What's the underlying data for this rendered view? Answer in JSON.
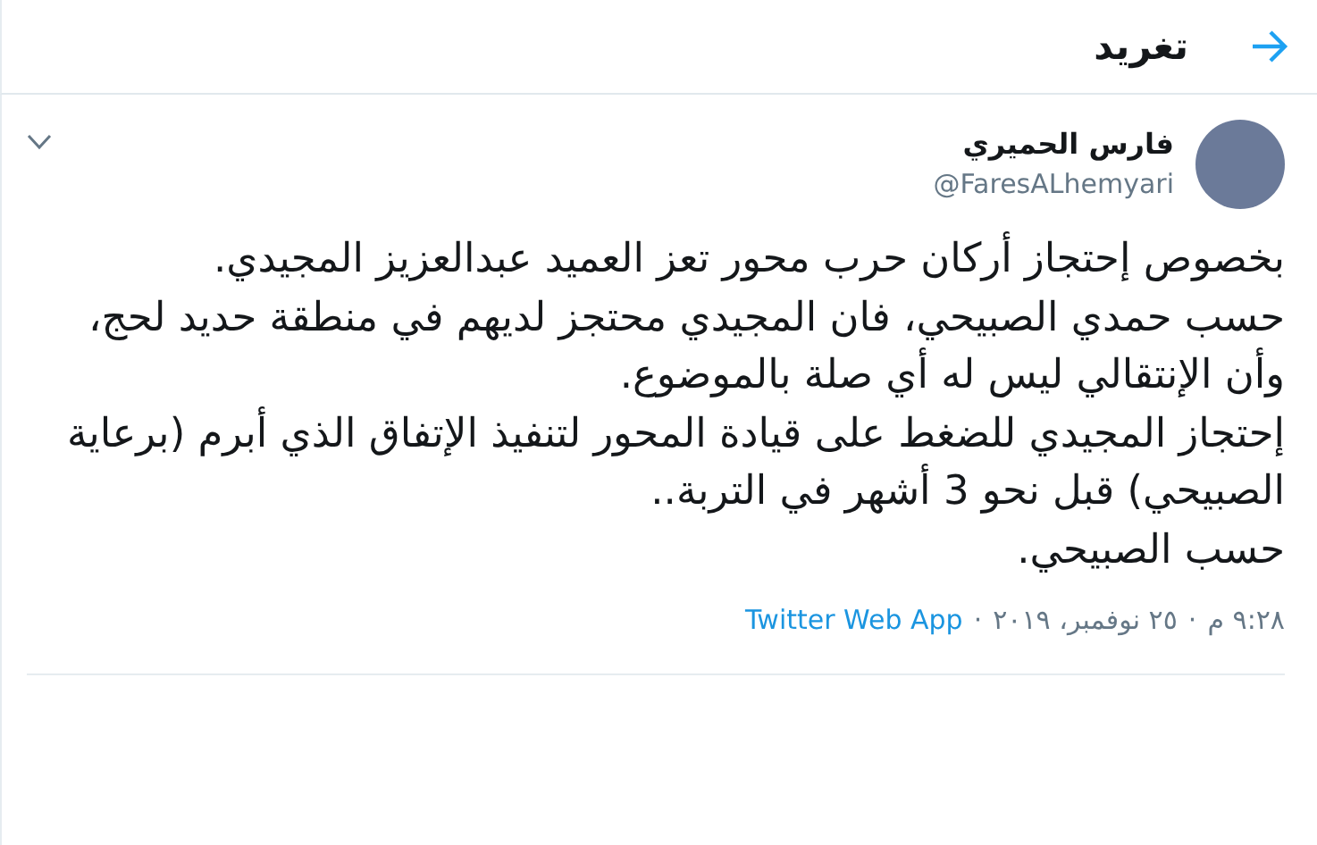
{
  "header": {
    "title": "تغريد"
  },
  "tweet": {
    "author": {
      "name": "فارس الحميري",
      "handle": "@FaresALhemyari"
    },
    "paragraphs": [
      "بخصوص إحتجاز أركان حرب محور تعز العميد عبدالعزيز المجيدي.",
      "حسب حمدي الصبيحي، فان المجيدي محتجز لديهم في منطقة حديد لحج، وأن الإنتقالي ليس له أي صلة بالموضوع.",
      "إحتجاز المجيدي للضغط على قيادة المحور لتنفيذ الإتفاق الذي أبرم (برعاية الصبيحي) قبل نحو 3 أشهر في التربة..",
      "حسب الصبيحي."
    ],
    "meta": {
      "time": "٩:٢٨ م",
      "separator": "·",
      "date": "٢٥ نوفمبر، ٢٠١٩",
      "source": "Twitter Web App"
    }
  }
}
